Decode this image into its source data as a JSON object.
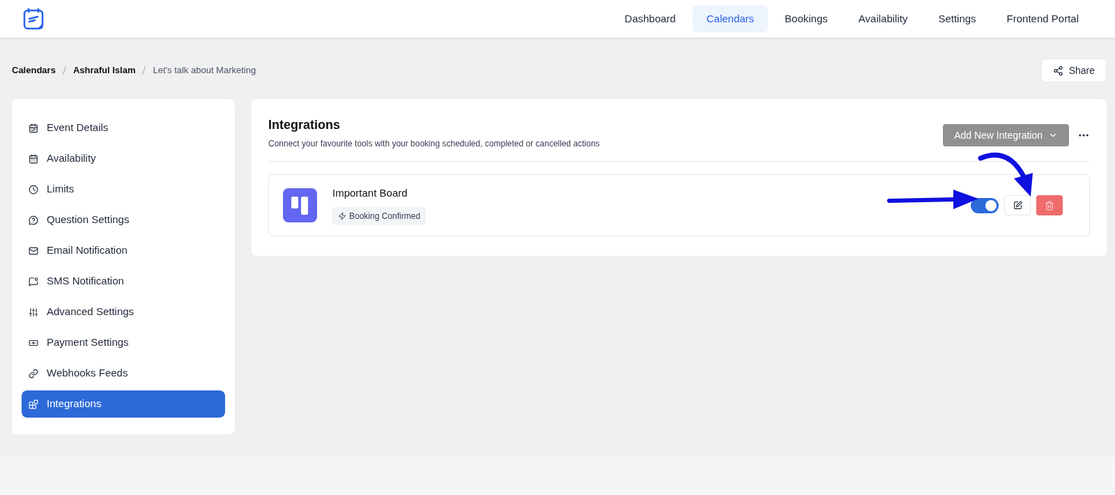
{
  "nav": {
    "items": [
      {
        "label": "Dashboard",
        "selected": false
      },
      {
        "label": "Calendars",
        "selected": true
      },
      {
        "label": "Bookings",
        "selected": false
      },
      {
        "label": "Availability",
        "selected": false
      },
      {
        "label": "Settings",
        "selected": false
      },
      {
        "label": "Frontend Portal",
        "selected": false
      }
    ]
  },
  "breadcrumb": [
    "Calendars",
    "Ashraful Islam",
    "Let's talk about Marketing"
  ],
  "share_button": "Share",
  "sidebar": {
    "items": [
      {
        "label": "Event Details",
        "selected": false
      },
      {
        "label": "Availability",
        "selected": false
      },
      {
        "label": "Limits",
        "selected": false
      },
      {
        "label": "Question Settings",
        "selected": false
      },
      {
        "label": "Email Notification",
        "selected": false
      },
      {
        "label": "SMS Notification",
        "selected": false
      },
      {
        "label": "Advanced Settings",
        "selected": false
      },
      {
        "label": "Payment Settings",
        "selected": false
      },
      {
        "label": "Webhooks Feeds",
        "selected": false
      },
      {
        "label": "Integrations",
        "selected": true
      }
    ]
  },
  "panel": {
    "title": "Integrations",
    "subtitle": "Connect your favourite tools with your booking scheduled, completed or cancelled actions",
    "add_button": "Add New Integration",
    "integrations": [
      {
        "name": "Important Board",
        "trigger": "Booking Confirmed",
        "on": true
      }
    ]
  }
}
